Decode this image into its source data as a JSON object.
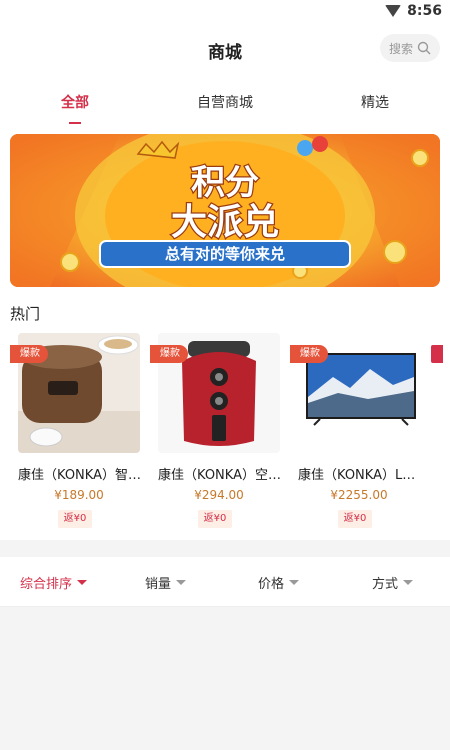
{
  "status": {
    "time": "8:56"
  },
  "header": {
    "title": "商城",
    "search_placeholder": "搜索"
  },
  "tabs": [
    {
      "label": "全部",
      "active": true
    },
    {
      "label": "自营商城",
      "active": false
    },
    {
      "label": "精选",
      "active": false
    }
  ],
  "banner": {
    "line1": "积分",
    "line2": "大派兑",
    "slogan": "总有对的等你来兑"
  },
  "hot": {
    "title": "热门",
    "products": [
      {
        "badge": "爆款",
        "name": "康佳（KONKA）智能电饭煲",
        "price": "¥189.00",
        "rebate": "返¥0",
        "image": "rice-cooker"
      },
      {
        "badge": "爆款",
        "name": "康佳（KONKA）空气炸锅",
        "price": "¥294.00",
        "rebate": "返¥0",
        "image": "air-fryer"
      },
      {
        "badge": "爆款",
        "name": "康佳（KONKA）LED电视",
        "price": "¥2255.00",
        "rebate": "返¥0",
        "image": "television"
      }
    ]
  },
  "sort": [
    {
      "label": "综合排序",
      "active": true
    },
    {
      "label": "销量",
      "active": false
    },
    {
      "label": "价格",
      "active": false
    },
    {
      "label": "方式",
      "active": false
    }
  ],
  "colors": {
    "accent": "#d4304a",
    "price": "#c7792b",
    "badge": "#e5533a"
  }
}
